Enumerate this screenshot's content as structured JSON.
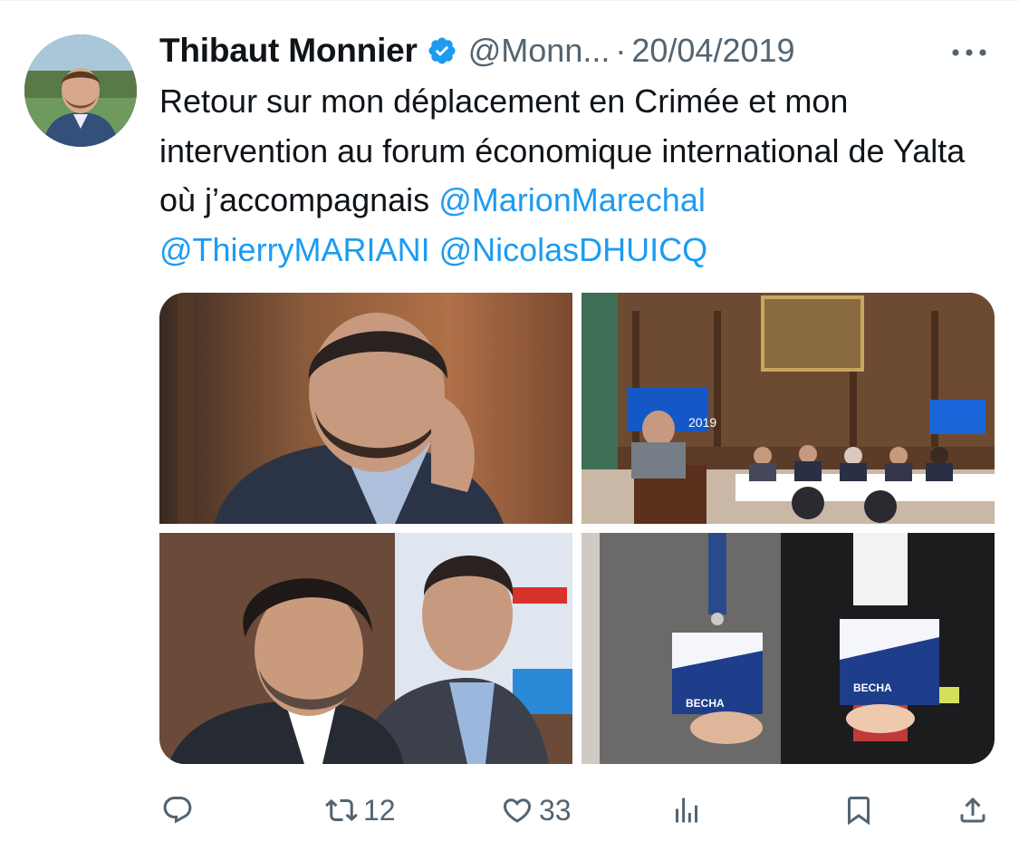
{
  "author": {
    "name": "Thibaut Monnier",
    "handle": "@Monn...",
    "separator": "·",
    "date": "20/04/2019",
    "verified_color": "#1d9bf0"
  },
  "tweet": {
    "text_segments": [
      {
        "text": "Retour sur mon déplacement en Crimée et mon intervention au forum économique international de Yalta où j’accompagnais ",
        "type": "plain"
      },
      {
        "text": "@MarionMarechal",
        "type": "mention"
      },
      {
        "text": " ",
        "type": "plain"
      },
      {
        "text": "@ThierryMARIANI",
        "type": "mention"
      },
      {
        "text": " ",
        "type": "plain"
      },
      {
        "text": "@NicolasDHUICQ",
        "type": "mention"
      }
    ]
  },
  "media": {
    "photos": [
      {
        "description_icon": "photo-portrait-man-listening"
      },
      {
        "description_icon": "photo-conference-hall-speaker"
      },
      {
        "description_icon": "photo-two-men-smiling"
      },
      {
        "description_icon": "photo-people-holding-brochures"
      }
    ],
    "screen_text": "2019",
    "brochure_text": "BECHA"
  },
  "actions": {
    "reply": {
      "icon": "reply-icon",
      "count": ""
    },
    "retweet": {
      "icon": "retweet-icon",
      "count": "12"
    },
    "like": {
      "icon": "heart-icon",
      "count": "33"
    },
    "views": {
      "icon": "views-icon",
      "count": ""
    },
    "bookmark": {
      "icon": "bookmark-icon"
    },
    "share": {
      "icon": "share-icon"
    }
  },
  "colors": {
    "accent": "#1d9bf0",
    "text": "#0f1419",
    "secondary": "#536471"
  }
}
